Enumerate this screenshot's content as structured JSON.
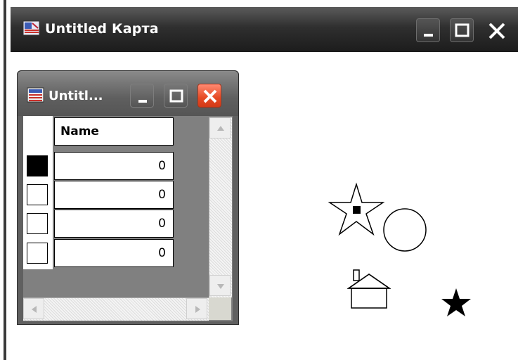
{
  "main_window": {
    "title": "Untitled Карта",
    "controls": {
      "minimize": "minimize",
      "maximize": "maximize",
      "close": "close"
    }
  },
  "child_window": {
    "title": "Untitl...",
    "table": {
      "column_header": "Name",
      "rows": [
        {
          "selected": true,
          "value": "0"
        },
        {
          "selected": false,
          "value": "0"
        },
        {
          "selected": false,
          "value": "0"
        },
        {
          "selected": false,
          "value": "0"
        }
      ]
    }
  },
  "map_symbols": [
    {
      "icon": "outline-star-with-square-icon"
    },
    {
      "icon": "circle-icon"
    },
    {
      "icon": "house-icon"
    },
    {
      "icon": "filled-star-icon"
    }
  ],
  "colors": {
    "titlebar_dark": "#2f2f2f",
    "close_red": "#e64a24",
    "grid_gray": "#808080"
  }
}
